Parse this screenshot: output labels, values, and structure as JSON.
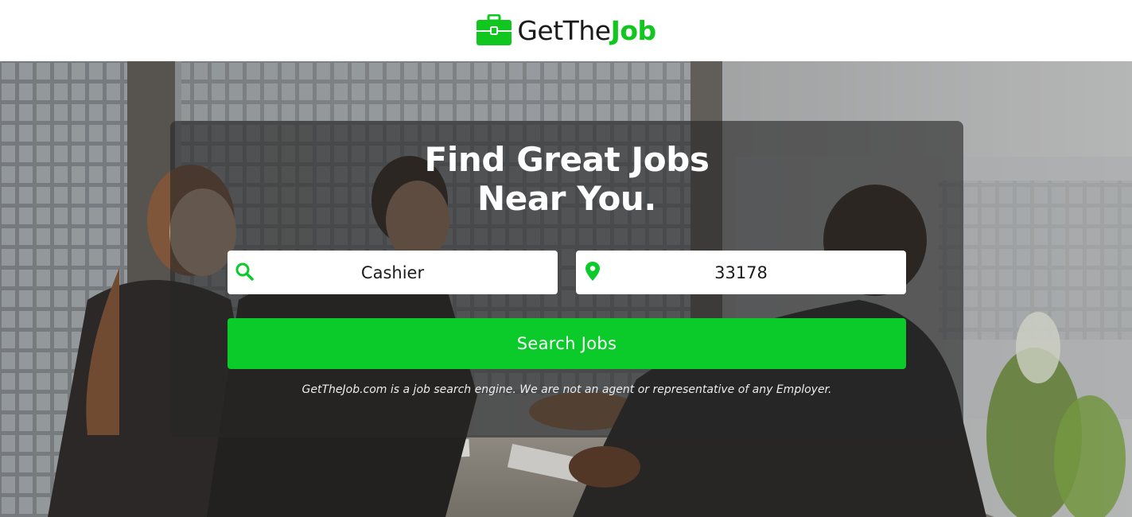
{
  "brand": {
    "name_part1": "GetThe",
    "name_part2": "Job",
    "logo_icon": "briefcase-icon",
    "accent_color": "#11c71f"
  },
  "hero": {
    "headline_line1": "Find Great Jobs",
    "headline_line2": "Near You."
  },
  "search": {
    "job_query": "Cashier",
    "job_icon": "search-icon",
    "location_query": "33178",
    "location_icon": "map-pin-icon",
    "button_label": "Search Jobs",
    "button_color": "#0acb2a"
  },
  "disclaimer": "GetTheJob.com is a job search engine. We are not an agent or representative of any Employer."
}
